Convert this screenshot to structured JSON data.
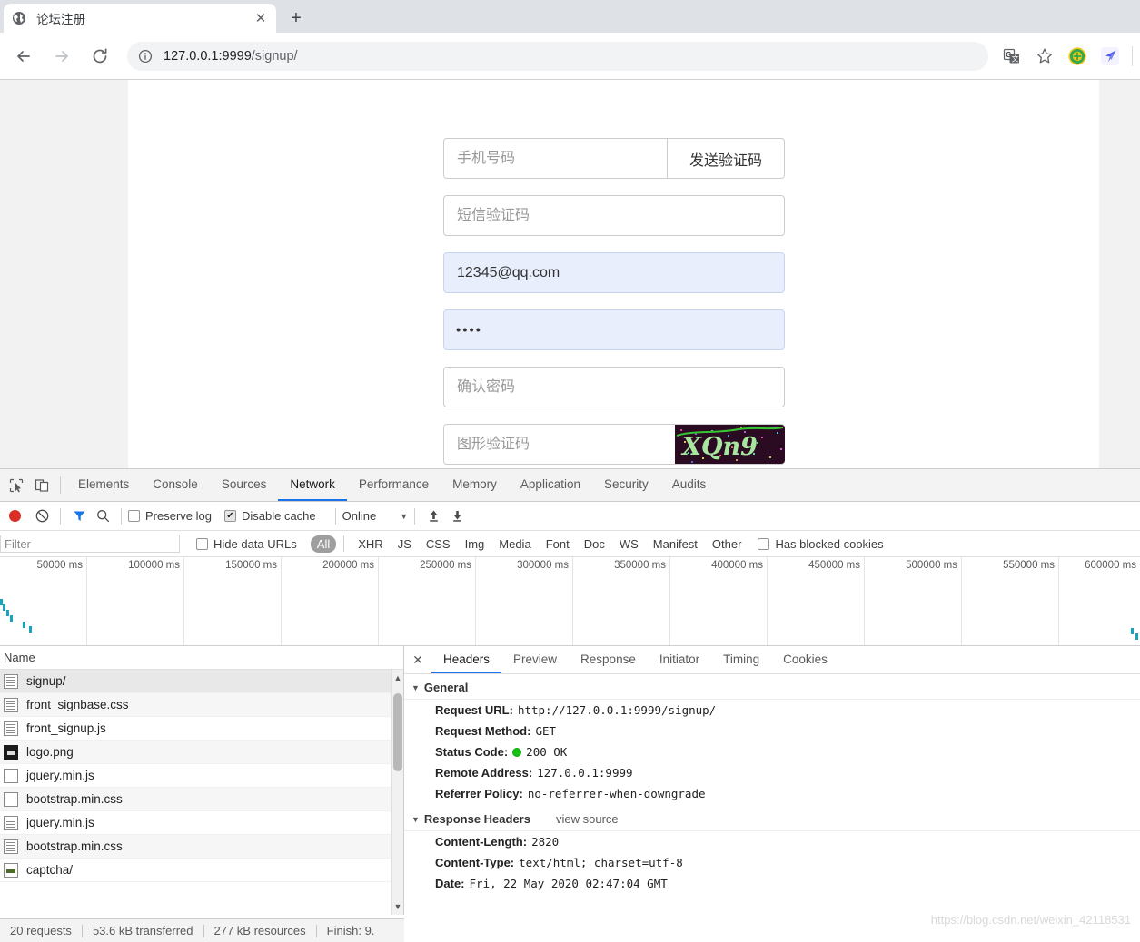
{
  "browser": {
    "tab": {
      "title": "论坛注册",
      "favicon": "globe-icon",
      "close": "✕"
    },
    "new_tab": "+",
    "nav": {
      "back": "←",
      "forward": "→",
      "reload": "⟳"
    },
    "omnibox": {
      "info_icon": "info-circle-icon",
      "url_host": "127.0.0.1:9999",
      "url_path": "/signup/"
    },
    "toolbar_icons": [
      "translate-icon",
      "bookmark-star-icon",
      "extension-green-icon",
      "extension-blue-icon"
    ]
  },
  "page": {
    "form": {
      "phone_placeholder": "手机号码",
      "send_code_label": "发送验证码",
      "sms_placeholder": "短信验证码",
      "email_value": "12345@qq.com",
      "password_value": "••••",
      "password_placeholder": "",
      "confirm_placeholder": "确认密码",
      "captcha_placeholder": "图形验证码",
      "captcha_text": "XQn9",
      "captcha_bg": "#2b0b22",
      "captcha_fg": "#a8e6a0"
    }
  },
  "devtools": {
    "tools": [
      "inspect-element-icon",
      "device-toolbar-icon"
    ],
    "tabs": [
      {
        "label": "Elements",
        "active": false
      },
      {
        "label": "Console",
        "active": false
      },
      {
        "label": "Sources",
        "active": false
      },
      {
        "label": "Network",
        "active": true
      },
      {
        "label": "Performance",
        "active": false
      },
      {
        "label": "Memory",
        "active": false
      },
      {
        "label": "Application",
        "active": false
      },
      {
        "label": "Security",
        "active": false
      },
      {
        "label": "Audits",
        "active": false
      }
    ],
    "toolbar": {
      "record_icon": "record-stop-icon",
      "clear_icon": "clear-icon",
      "filter_icon": "filter-funnel-icon",
      "search_icon": "search-icon",
      "preserve_log_label": "Preserve log",
      "preserve_log_checked": false,
      "disable_cache_label": "Disable cache",
      "disable_cache_checked": true,
      "throttle_value": "Online",
      "throttle_caret": "▼",
      "import_icon": "upload-arrow-icon",
      "export_icon": "download-arrow-icon"
    },
    "filterbar": {
      "filter_placeholder": "Filter",
      "hide_data_urls_label": "Hide data URLs",
      "hide_data_urls_checked": false,
      "types": [
        "All",
        "XHR",
        "JS",
        "CSS",
        "Img",
        "Media",
        "Font",
        "Doc",
        "WS",
        "Manifest",
        "Other"
      ],
      "active_type": "All",
      "has_blocked_cookies_label": "Has blocked cookies",
      "has_blocked_cookies_checked": false
    },
    "overview": {
      "ticks": [
        "50000 ms",
        "100000 ms",
        "150000 ms",
        "200000 ms",
        "250000 ms",
        "300000 ms",
        "350000 ms",
        "400000 ms",
        "450000 ms",
        "500000 ms",
        "550000 ms",
        "600000 ms"
      ]
    },
    "requests": {
      "column_header": "Name",
      "rows": [
        {
          "name": "signup/",
          "icon": "document-icon",
          "selected": true
        },
        {
          "name": "front_signbase.css",
          "icon": "document-icon",
          "selected": false
        },
        {
          "name": "front_signup.js",
          "icon": "document-icon",
          "selected": false
        },
        {
          "name": "logo.png",
          "icon": "image-icon",
          "selected": false
        },
        {
          "name": "jquery.min.js",
          "icon": "blank-icon",
          "selected": false
        },
        {
          "name": "bootstrap.min.css",
          "icon": "blank-icon",
          "selected": false
        },
        {
          "name": "jquery.min.js",
          "icon": "document-icon",
          "selected": false
        },
        {
          "name": "bootstrap.min.css",
          "icon": "document-icon",
          "selected": false
        },
        {
          "name": "captcha/",
          "icon": "image-green-icon",
          "selected": false
        }
      ]
    },
    "details": {
      "close_icon": "✕",
      "tabs": [
        {
          "label": "Headers",
          "active": true
        },
        {
          "label": "Preview",
          "active": false
        },
        {
          "label": "Response",
          "active": false
        },
        {
          "label": "Initiator",
          "active": false
        },
        {
          "label": "Timing",
          "active": false
        },
        {
          "label": "Cookies",
          "active": false
        }
      ],
      "general": {
        "title": "General",
        "triangle": "▼",
        "rows": [
          {
            "key": "Request URL:",
            "value": "http://127.0.0.1:9999/signup/"
          },
          {
            "key": "Request Method:",
            "value": "GET"
          },
          {
            "key": "Status Code:",
            "value": "200 OK",
            "status_dot": "#15c213"
          },
          {
            "key": "Remote Address:",
            "value": "127.0.0.1:9999"
          },
          {
            "key": "Referrer Policy:",
            "value": "no-referrer-when-downgrade"
          }
        ]
      },
      "response_headers": {
        "title": "Response Headers",
        "triangle": "▼",
        "view_source": "view source",
        "rows": [
          {
            "key": "Content-Length:",
            "value": "2820"
          },
          {
            "key": "Content-Type:",
            "value": "text/html; charset=utf-8"
          },
          {
            "key": "Date:",
            "value": "Fri, 22 May 2020 02:47:04 GMT"
          }
        ]
      }
    },
    "status": {
      "requests": "20 requests",
      "transferred": "53.6 kB transferred",
      "resources": "277 kB resources",
      "finish": "Finish: 9."
    }
  },
  "watermark": "https://blog.csdn.net/weixin_42118531"
}
